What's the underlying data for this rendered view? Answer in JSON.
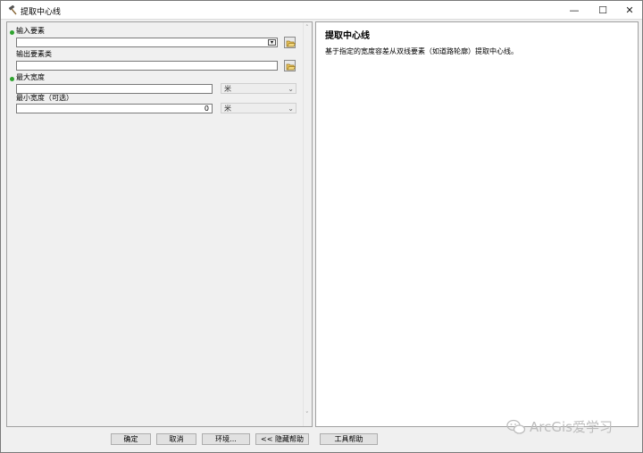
{
  "window": {
    "title": "提取中心线",
    "minimize_symbol": "—",
    "maximize_symbol": "☐",
    "close_symbol": "✕"
  },
  "params": {
    "input_features": {
      "label": "输入要素",
      "value": ""
    },
    "output_feature_class": {
      "label": "输出要素类",
      "value": ""
    },
    "max_width": {
      "label": "最大宽度",
      "value": "",
      "unit": "米"
    },
    "min_width": {
      "label": "最小宽度（可选）",
      "value": "0",
      "unit": "米"
    }
  },
  "help": {
    "title": "提取中心线",
    "description": "基于指定的宽度容差从双线要素（如道路轮廓）提取中心线。"
  },
  "buttons": {
    "ok": "确定",
    "cancel": "取消",
    "env": "环境...",
    "hide_help": "<< 隐藏帮助",
    "tool_help": "工具帮助"
  },
  "watermark": {
    "text": "ArcGis爱学习"
  },
  "colors": {
    "required_dot": "#2fa32f",
    "panel_bg": "#f0f0f0",
    "help_bg": "#ffffff"
  },
  "icons": {
    "title": "hammer-icon",
    "browse": "open-folder-icon",
    "watermark": "wechat-icon"
  }
}
